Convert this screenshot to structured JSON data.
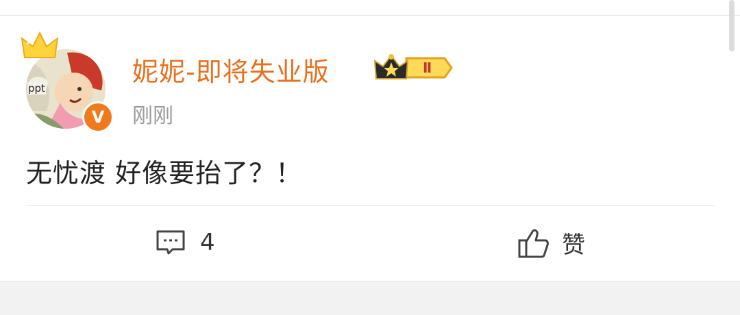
{
  "post": {
    "username": "妮妮-即将失业版",
    "level_badge": "Ⅱ",
    "avatar_text": "ppt",
    "verified_mark": "V",
    "time": "刚刚",
    "content": "无忧渡 好像要抬了？！"
  },
  "actions": {
    "comment_count": "4",
    "like_label": "赞"
  },
  "colors": {
    "username": "#e8701d",
    "verified_badge": "#f07b1f",
    "timestamp": "#9a9a9a"
  },
  "icons": [
    "crown-icon",
    "verified-icon",
    "level-crown-icon",
    "comment-icon",
    "thumbs-up-icon"
  ]
}
